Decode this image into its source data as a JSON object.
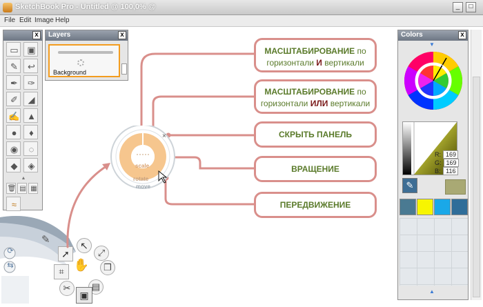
{
  "window": {
    "title": "SketchBook Pro - Untitled @ 100,0% @",
    "minimize": "_",
    "maximize": "□"
  },
  "menu": [
    "File",
    "Edit",
    "Image",
    "Help"
  ],
  "layers": {
    "title": "Layers",
    "close": "x",
    "layer_name": "Background"
  },
  "colors": {
    "title": "Colors",
    "close": "x",
    "r_label": "R:",
    "r_value": "169",
    "g_label": "G:",
    "g_value": "169",
    "b_label": "B:",
    "b_value": "116",
    "current_color": "#a9a974",
    "swatches": [
      "#4a7a92",
      "#f7f500",
      "#1aa8e8",
      "#2f6d99"
    ]
  },
  "toolbox": {
    "close": "x"
  },
  "puck": {
    "scale_label": "scale",
    "rotate_label": "rotate",
    "move_label": "move",
    "close": "×"
  },
  "callouts": {
    "zoom_and": {
      "line1_bold": "МАСШТАБИРОВАНИЕ",
      "line1_rest": "по",
      "line2_a": "горизонтали",
      "line2_b": "И",
      "line2_c": "вертикали"
    },
    "zoom_or": {
      "line1_bold": "МАСШТАБИРОВАНИЕ",
      "line1_rest": "по",
      "line2_a": "горизонтали",
      "line2_b": "ИЛИ",
      "line2_c": "вертикали"
    },
    "hide_panel": "СКРЫТЬ ПАНЕЛЬ",
    "rotate": "ВРАЩЕНИЕ",
    "move": "ПЕРЕДВИЖЕНИЕ"
  },
  "accent_colors": {
    "callout_border": "#d98f8b",
    "callout_text": "#5a7a2a",
    "callout_emphasis": "#7a1a1a",
    "puck_fill": "#f6c68e"
  }
}
